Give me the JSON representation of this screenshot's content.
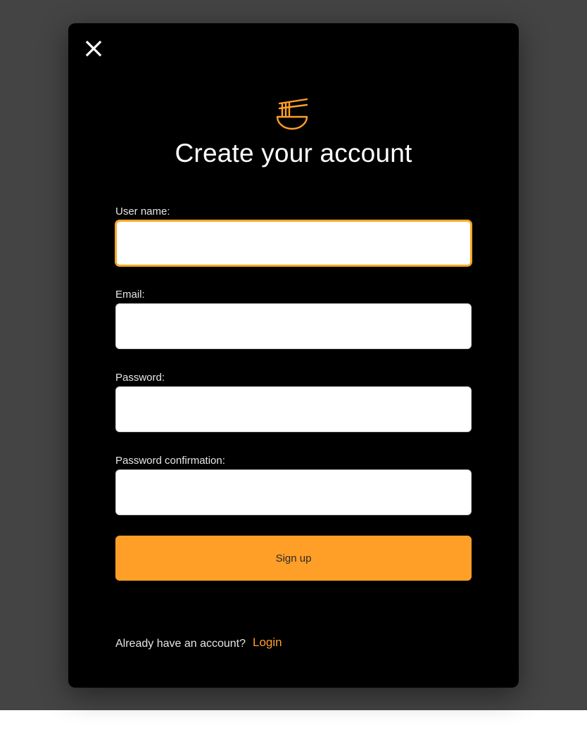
{
  "modal": {
    "title": "Create your account",
    "icons": {
      "close": "close-icon",
      "logo": "noodle-bowl-icon"
    },
    "fields": [
      {
        "label": "User name:",
        "value": "",
        "focused": true
      },
      {
        "label": "Email:",
        "value": ""
      },
      {
        "label": "Password:",
        "value": ""
      },
      {
        "label": "Password confirmation:",
        "value": ""
      }
    ],
    "submit_label": "Sign up",
    "footer": {
      "prompt": "Already have an account?",
      "login_label": "Login"
    }
  },
  "colors": {
    "accent": "#ff9f27",
    "modal_bg": "#000000",
    "backdrop": "#444444",
    "text": "#ffffff"
  }
}
